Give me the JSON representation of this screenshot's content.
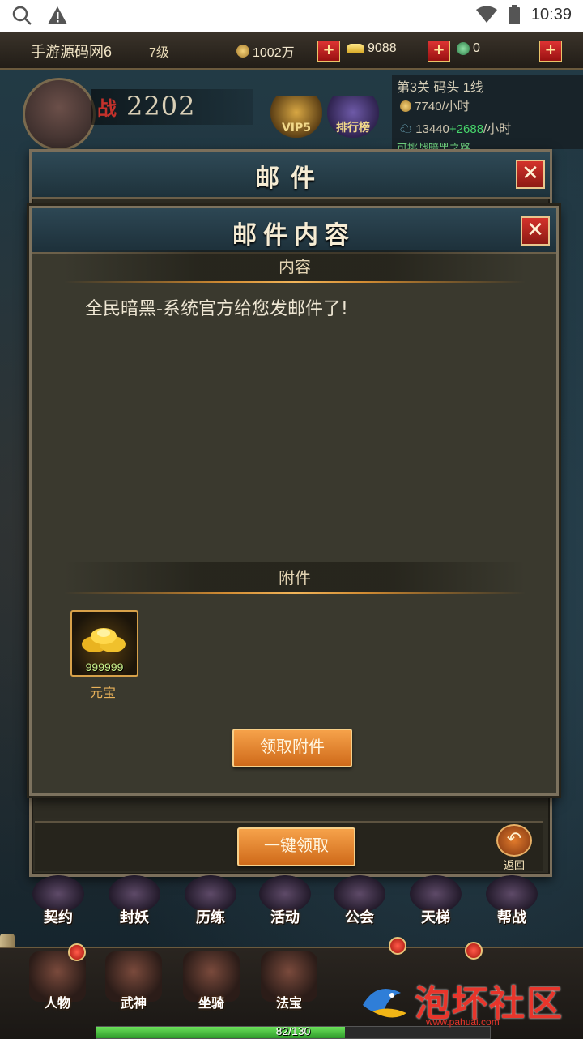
{
  "status_bar": {
    "time": "10:39"
  },
  "hud": {
    "player_name": "手游源码网6",
    "level": "7级",
    "copper": "1002万",
    "gold_ingot": "9088",
    "jade": "0",
    "plus_label": "+"
  },
  "profile": {
    "power_label": "战",
    "power_value": "2202",
    "vip_label": "VIP5",
    "rank_label": "排行榜"
  },
  "stage": {
    "title": "第3关 码头 1线",
    "copper_rate": "7740/小时",
    "exp_base": "13440",
    "exp_bonus": "+2688",
    "exp_unit": "/小时",
    "hint": "可挑战暗黑之路"
  },
  "mail_window": {
    "title": "邮件",
    "claim_all_label": "一键领取",
    "return_label": "返回"
  },
  "mail_content": {
    "title": "邮件内容",
    "content_header": "内容",
    "message": "全民暗黑-系统官方给您发邮件了!",
    "attachment_header": "附件",
    "attachments": [
      {
        "name": "元宝",
        "quantity": "999999"
      }
    ],
    "claim_label": "领取附件"
  },
  "menu_row": [
    "契约",
    "封妖",
    "历练",
    "活动",
    "公会",
    "天梯",
    "帮战"
  ],
  "dock": [
    "人物",
    "武神",
    "坐骑",
    "法宝"
  ],
  "exp": {
    "text": "82/130",
    "current": 82,
    "max": 130
  },
  "watermark": {
    "text": "泡坏社区",
    "url": "www.pahuai.com"
  },
  "colors": {
    "accent_orange": "#cf6a1a",
    "close_red": "#d3332b",
    "title_text": "#f5ecd4",
    "item_name": "#e9b25a"
  }
}
